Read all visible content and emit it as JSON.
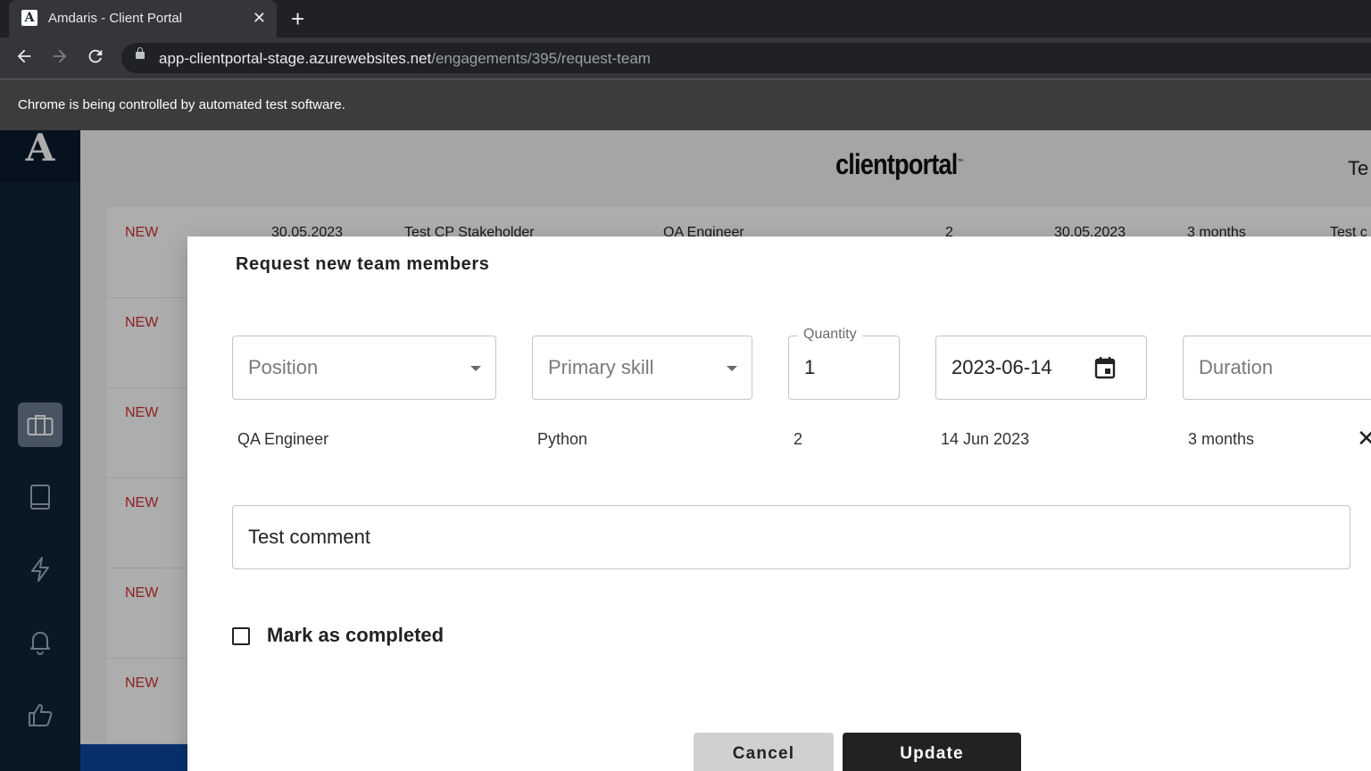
{
  "browser": {
    "tab_title": "Amdaris - Client Portal",
    "tab_favicon_letter": "A",
    "tab_close": "✕",
    "new_tab": "+",
    "url_host": "app-clientportal-stage.azurewebsites.net",
    "url_path": "/engagements/395/request-team",
    "infobar_text": "Chrome is being controlled by automated test software."
  },
  "app": {
    "logo_letter": "A",
    "brand": "clientportal",
    "brand_tm": "™",
    "user_partial": "Te",
    "sidebar_icons": [
      "briefcase-icon",
      "book-icon",
      "lightning-icon",
      "bell-icon",
      "thumbs-up-icon"
    ],
    "rows": [
      {
        "status": "NEW",
        "date": "30.05.2023",
        "stakeholder": "Test CP Stakeholder",
        "position": "QA Engineer",
        "qty": "2",
        "start": "30.05.2023",
        "duration": "3 months",
        "comment": "Test c"
      },
      {
        "status": "NEW"
      },
      {
        "status": "NEW"
      },
      {
        "status": "NEW"
      },
      {
        "status": "NEW"
      },
      {
        "status": "NEW"
      }
    ]
  },
  "modal": {
    "heading": "Request new team members",
    "position_placeholder": "Position",
    "primary_skill_placeholder": "Primary skill",
    "quantity_label": "Quantity",
    "quantity_value": "1",
    "date_value": "2023-06-14",
    "duration_placeholder": "Duration",
    "entry": {
      "position": "QA Engineer",
      "skill": "Python",
      "quantity": "2",
      "date": "14 Jun 2023",
      "duration": "3 months",
      "remove": "✕"
    },
    "comment_value": "Test comment",
    "mark_completed_label": "Mark as completed",
    "mark_completed_checked": false,
    "cancel_label": "Cancel",
    "update_label": "Update"
  },
  "colors": {
    "status_new": "#d32f2f",
    "sidebar_bg": "#0f2438",
    "update_bg": "#222222",
    "cancel_bg": "#d0d0d0"
  }
}
